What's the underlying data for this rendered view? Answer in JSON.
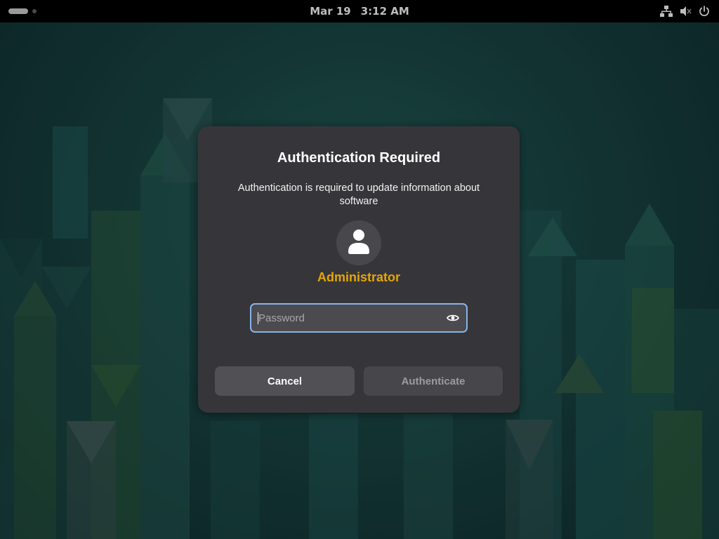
{
  "topbar": {
    "date": "Mar 19",
    "time": "3:12 AM",
    "activities_icon": "activities-indicator",
    "tray_icons": [
      "network-wired-icon",
      "volume-muted-icon",
      "power-icon"
    ]
  },
  "dialog": {
    "title": "Authentication Required",
    "message": "Authentication is required to update information about software",
    "avatar_icon": "user-icon",
    "username": "Administrator",
    "password": {
      "value": "",
      "placeholder": "Password",
      "reveal_icon": "eye-icon"
    },
    "cancel_label": "Cancel",
    "authenticate_label": "Authenticate"
  },
  "colors": {
    "topbar_bg": "#000000",
    "dialog_bg": "#36363a",
    "username": "#e5a50a",
    "focus_ring": "#8ab4e8",
    "wallpaper_base": "#173f3e"
  }
}
